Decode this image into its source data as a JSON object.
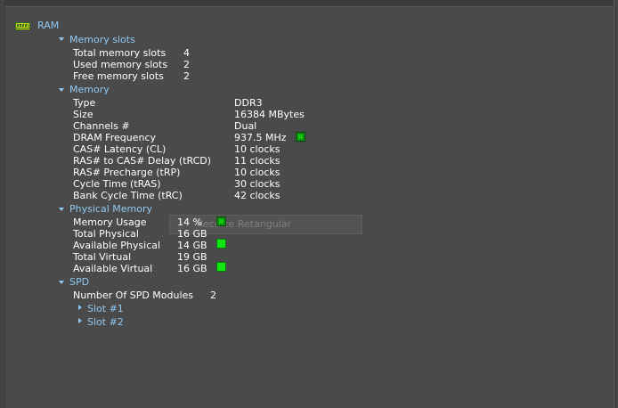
{
  "root": {
    "label": "RAM"
  },
  "memory_slots": {
    "label": "Memory slots",
    "rows": [
      {
        "k": "Total memory slots",
        "v": "4"
      },
      {
        "k": "Used memory slots",
        "v": "2"
      },
      {
        "k": "Free memory slots",
        "v": "2"
      }
    ]
  },
  "memory": {
    "label": "Memory",
    "rows": [
      {
        "k": "Type",
        "v": "DDR3"
      },
      {
        "k": "Size",
        "v": "16384 MBytes"
      },
      {
        "k": "Channels #",
        "v": "Dual"
      },
      {
        "k": "DRAM Frequency",
        "v": "937.5 MHz"
      },
      {
        "k": "CAS# Latency (CL)",
        "v": "10 clocks"
      },
      {
        "k": "RAS# to CAS# Delay (tRCD)",
        "v": "11 clocks"
      },
      {
        "k": "RAS# Precharge (tRP)",
        "v": "10 clocks"
      },
      {
        "k": "Cycle Time (tRAS)",
        "v": "30 clocks"
      },
      {
        "k": "Bank Cycle Time (tRC)",
        "v": "42 clocks"
      }
    ]
  },
  "physical_memory": {
    "label": "Physical Memory",
    "rows": [
      {
        "k": "Memory Usage",
        "v": "14 %"
      },
      {
        "k": "Total Physical",
        "v": "16 GB"
      },
      {
        "k": "Available Physical",
        "v": "14 GB"
      },
      {
        "k": "Total Virtual",
        "v": "19 GB"
      },
      {
        "k": "Available Virtual",
        "v": "16 GB"
      }
    ]
  },
  "spd": {
    "label": "SPD",
    "modules_label": "Number Of SPD Modules",
    "modules_value": "2",
    "slots": [
      "Slot #1",
      "Slot #2"
    ]
  },
  "tooltip": {
    "text": "Recorte Retangular"
  },
  "colors": {
    "background": "#4a4a4a",
    "link": "#8fc8f2",
    "indicator": "#13e613"
  }
}
